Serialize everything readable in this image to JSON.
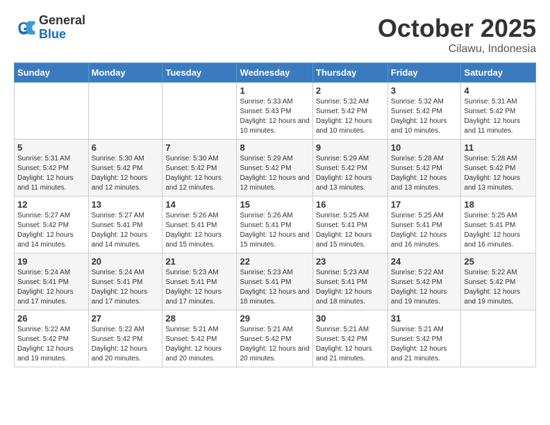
{
  "header": {
    "logo_general": "General",
    "logo_blue": "Blue",
    "month": "October 2025",
    "location": "Cilawu, Indonesia"
  },
  "days_of_week": [
    "Sunday",
    "Monday",
    "Tuesday",
    "Wednesday",
    "Thursday",
    "Friday",
    "Saturday"
  ],
  "weeks": [
    [
      {
        "day": "",
        "info": ""
      },
      {
        "day": "",
        "info": ""
      },
      {
        "day": "",
        "info": ""
      },
      {
        "day": "1",
        "info": "Sunrise: 5:33 AM\nSunset: 5:43 PM\nDaylight: 12 hours\nand 10 minutes."
      },
      {
        "day": "2",
        "info": "Sunrise: 5:32 AM\nSunset: 5:42 PM\nDaylight: 12 hours\nand 10 minutes."
      },
      {
        "day": "3",
        "info": "Sunrise: 5:32 AM\nSunset: 5:42 PM\nDaylight: 12 hours\nand 10 minutes."
      },
      {
        "day": "4",
        "info": "Sunrise: 5:31 AM\nSunset: 5:42 PM\nDaylight: 12 hours\nand 11 minutes."
      }
    ],
    [
      {
        "day": "5",
        "info": "Sunrise: 5:31 AM\nSunset: 5:42 PM\nDaylight: 12 hours\nand 11 minutes."
      },
      {
        "day": "6",
        "info": "Sunrise: 5:30 AM\nSunset: 5:42 PM\nDaylight: 12 hours\nand 12 minutes."
      },
      {
        "day": "7",
        "info": "Sunrise: 5:30 AM\nSunset: 5:42 PM\nDaylight: 12 hours\nand 12 minutes."
      },
      {
        "day": "8",
        "info": "Sunrise: 5:29 AM\nSunset: 5:42 PM\nDaylight: 12 hours\nand 12 minutes."
      },
      {
        "day": "9",
        "info": "Sunrise: 5:29 AM\nSunset: 5:42 PM\nDaylight: 12 hours\nand 13 minutes."
      },
      {
        "day": "10",
        "info": "Sunrise: 5:28 AM\nSunset: 5:42 PM\nDaylight: 12 hours\nand 13 minutes."
      },
      {
        "day": "11",
        "info": "Sunrise: 5:28 AM\nSunset: 5:42 PM\nDaylight: 12 hours\nand 13 minutes."
      }
    ],
    [
      {
        "day": "12",
        "info": "Sunrise: 5:27 AM\nSunset: 5:42 PM\nDaylight: 12 hours\nand 14 minutes."
      },
      {
        "day": "13",
        "info": "Sunrise: 5:27 AM\nSunset: 5:41 PM\nDaylight: 12 hours\nand 14 minutes."
      },
      {
        "day": "14",
        "info": "Sunrise: 5:26 AM\nSunset: 5:41 PM\nDaylight: 12 hours\nand 15 minutes."
      },
      {
        "day": "15",
        "info": "Sunrise: 5:26 AM\nSunset: 5:41 PM\nDaylight: 12 hours\nand 15 minutes."
      },
      {
        "day": "16",
        "info": "Sunrise: 5:25 AM\nSunset: 5:41 PM\nDaylight: 12 hours\nand 15 minutes."
      },
      {
        "day": "17",
        "info": "Sunrise: 5:25 AM\nSunset: 5:41 PM\nDaylight: 12 hours\nand 16 minutes."
      },
      {
        "day": "18",
        "info": "Sunrise: 5:25 AM\nSunset: 5:41 PM\nDaylight: 12 hours\nand 16 minutes."
      }
    ],
    [
      {
        "day": "19",
        "info": "Sunrise: 5:24 AM\nSunset: 5:41 PM\nDaylight: 12 hours\nand 17 minutes."
      },
      {
        "day": "20",
        "info": "Sunrise: 5:24 AM\nSunset: 5:41 PM\nDaylight: 12 hours\nand 17 minutes."
      },
      {
        "day": "21",
        "info": "Sunrise: 5:23 AM\nSunset: 5:41 PM\nDaylight: 12 hours\nand 17 minutes."
      },
      {
        "day": "22",
        "info": "Sunrise: 5:23 AM\nSunset: 5:41 PM\nDaylight: 12 hours\nand 18 minutes."
      },
      {
        "day": "23",
        "info": "Sunrise: 5:23 AM\nSunset: 5:41 PM\nDaylight: 12 hours\nand 18 minutes."
      },
      {
        "day": "24",
        "info": "Sunrise: 5:22 AM\nSunset: 5:42 PM\nDaylight: 12 hours\nand 19 minutes."
      },
      {
        "day": "25",
        "info": "Sunrise: 5:22 AM\nSunset: 5:42 PM\nDaylight: 12 hours\nand 19 minutes."
      }
    ],
    [
      {
        "day": "26",
        "info": "Sunrise: 5:22 AM\nSunset: 5:42 PM\nDaylight: 12 hours\nand 19 minutes."
      },
      {
        "day": "27",
        "info": "Sunrise: 5:22 AM\nSunset: 5:42 PM\nDaylight: 12 hours\nand 20 minutes."
      },
      {
        "day": "28",
        "info": "Sunrise: 5:21 AM\nSunset: 5:42 PM\nDaylight: 12 hours\nand 20 minutes."
      },
      {
        "day": "29",
        "info": "Sunrise: 5:21 AM\nSunset: 5:42 PM\nDaylight: 12 hours\nand 20 minutes."
      },
      {
        "day": "30",
        "info": "Sunrise: 5:21 AM\nSunset: 5:42 PM\nDaylight: 12 hours\nand 21 minutes."
      },
      {
        "day": "31",
        "info": "Sunrise: 5:21 AM\nSunset: 5:42 PM\nDaylight: 12 hours\nand 21 minutes."
      },
      {
        "day": "",
        "info": ""
      }
    ]
  ]
}
